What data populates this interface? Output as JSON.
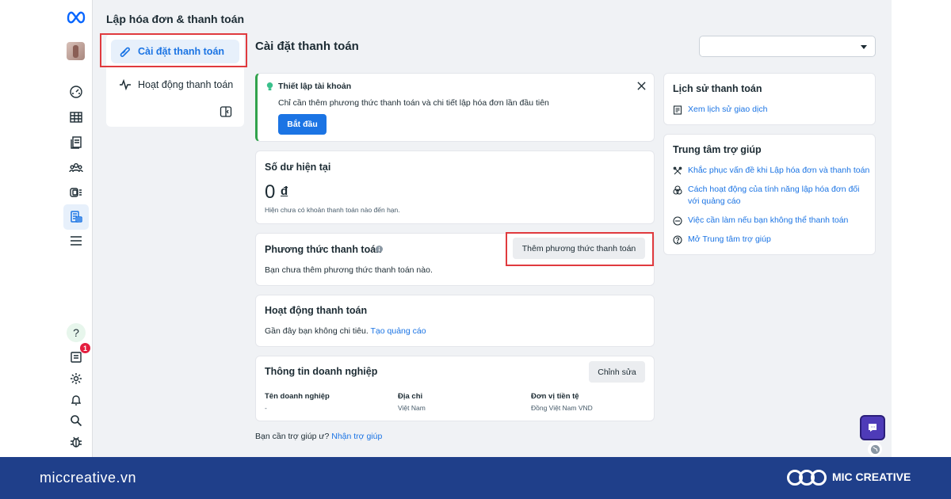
{
  "app": {
    "page_heading": "Lập hóa đơn & thanh toán"
  },
  "subnav": {
    "items": [
      {
        "label": "Cài đặt thanh toán",
        "active": true
      },
      {
        "label": "Hoạt động thanh toán",
        "active": false
      }
    ]
  },
  "main": {
    "title": "Cài đặt thanh toán",
    "dropdown_value": ""
  },
  "setup": {
    "title": "Thiết lập tài khoản",
    "description": "Chỉ cần thêm phương thức thanh toán và chi tiết lập hóa đơn lần đầu tiên",
    "button": "Bắt đầu"
  },
  "balance": {
    "title": "Số dư hiện tại",
    "amount": "0",
    "currency_symbol": "đ",
    "note": "Hiện chưa có khoản thanh toán nào đến hạn."
  },
  "payment_method": {
    "title": "Phương thức thanh toán",
    "add_button": "Thêm phương thức thanh toán",
    "empty_text": "Bạn chưa thêm phương thức thanh toán nào."
  },
  "activity": {
    "title": "Hoạt động thanh toán",
    "text": "Gần đây bạn không chi tiêu.",
    "link": "Tạo quảng cáo"
  },
  "business": {
    "title": "Thông tin doanh nghiệp",
    "edit_button": "Chỉnh sửa",
    "columns": [
      {
        "label": "Tên doanh nghiệp",
        "value": "-"
      },
      {
        "label": "Địa chỉ",
        "value": "Việt Nam"
      },
      {
        "label": "Đơn vị tiền tệ",
        "value": "Đồng Việt Nam VND"
      }
    ]
  },
  "footer_help": {
    "text": "Bạn cần trợ giúp ư?",
    "link": "Nhận trợ giúp"
  },
  "history": {
    "title": "Lịch sử thanh toán",
    "link": "Xem lịch sử giao dịch"
  },
  "help_center": {
    "title": "Trung tâm trợ giúp",
    "links": [
      {
        "label": "Khắc phục vấn đề khi Lập hóa đơn và thanh toán",
        "icon": "tools-icon"
      },
      {
        "label": "Cách hoạt động của tính năng lập hóa đơn đối với quảng cáo",
        "icon": "circles-icon"
      },
      {
        "label": "Việc cần làm nếu bạn không thể thanh toán",
        "icon": "minus-circle-icon"
      },
      {
        "label": "Mở Trung tâm trợ giúp",
        "icon": "question-circle-icon"
      }
    ]
  },
  "rail": {
    "notification_count": "1"
  },
  "banner": {
    "site": "miccreative.vn",
    "brand": "MIC CREATIVE"
  },
  "colors": {
    "accent": "#1b74e4",
    "highlight_box": "#e03a3e",
    "banner": "#1f3f8a",
    "setup_border": "#31a24c"
  }
}
